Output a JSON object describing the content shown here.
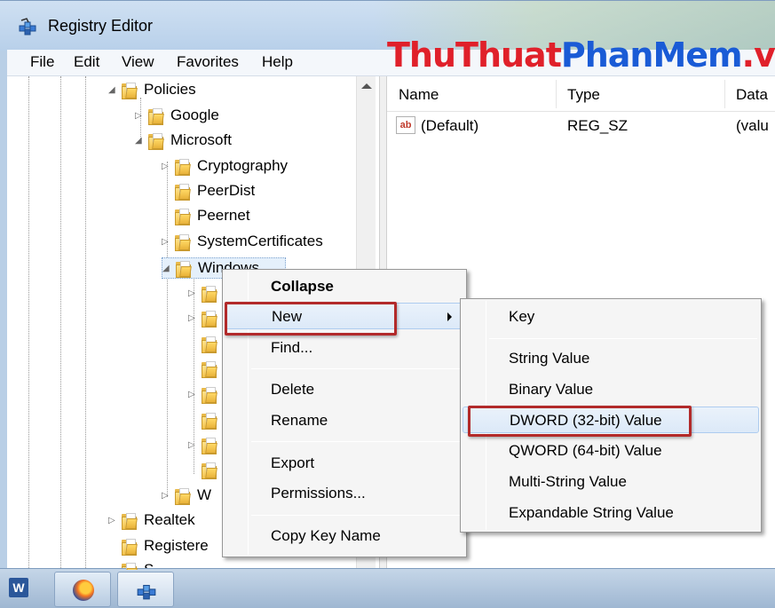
{
  "window": {
    "title": "Registry Editor",
    "icon": "registry-editor-icon"
  },
  "watermark": {
    "part1": "ThuThuat",
    "part2": "PhanMem",
    "part3": ".vn"
  },
  "menubar": [
    "File",
    "Edit",
    "View",
    "Favorites",
    "Help"
  ],
  "tree": {
    "nodes": [
      {
        "label": "Policies"
      },
      {
        "label": "Google"
      },
      {
        "label": "Microsoft"
      },
      {
        "label": "Cryptography"
      },
      {
        "label": "PeerDist"
      },
      {
        "label": "Peernet"
      },
      {
        "label": "SystemCertificates"
      },
      {
        "label": "Windows"
      },
      {
        "label": "W"
      },
      {
        "label": "Realtek"
      },
      {
        "label": "Registere"
      },
      {
        "label": "S"
      }
    ]
  },
  "list": {
    "columns": [
      "Name",
      "Type",
      "Data"
    ],
    "rows": [
      {
        "name": "(Default)",
        "type": "REG_SZ",
        "data": "(valu"
      }
    ]
  },
  "context_menu": {
    "items": [
      "Collapse",
      "New",
      "Find...",
      "Delete",
      "Rename",
      "Export",
      "Permissions...",
      "Copy Key Name"
    ],
    "highlighted": "New"
  },
  "submenu": {
    "items": [
      "Key",
      "String Value",
      "Binary Value",
      "DWORD (32-bit) Value",
      "QWORD (64-bit) Value",
      "Multi-String Value",
      "Expandable String Value"
    ],
    "highlighted": "DWORD (32-bit) Value"
  },
  "taskbar": {
    "items": [
      {
        "icon": "word-icon",
        "glyph": "W"
      },
      {
        "icon": "firefox-icon"
      },
      {
        "icon": "registry-editor-icon"
      }
    ]
  },
  "colors": {
    "highlight_box": "#b22a2a",
    "menu_bg": "#f5f5f5",
    "title_bar": "#cfe0f2"
  }
}
